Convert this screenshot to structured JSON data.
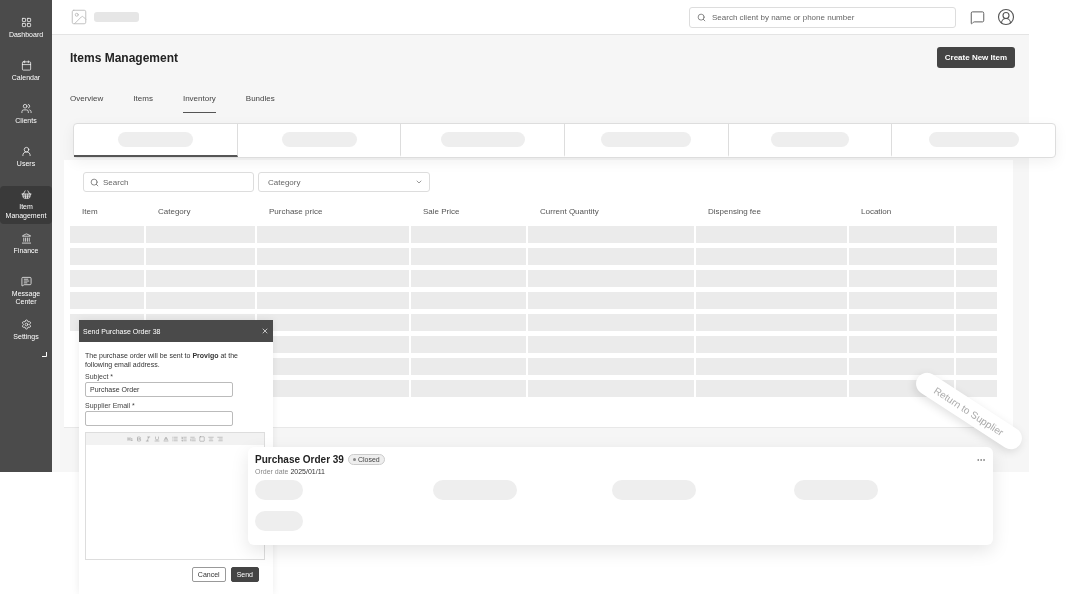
{
  "sidebar": {
    "items": [
      {
        "label": "Dashboard",
        "selected": false
      },
      {
        "label": "Calendar",
        "selected": false
      },
      {
        "label": "Clients",
        "selected": false
      },
      {
        "label": "Users",
        "selected": false
      },
      {
        "label": "Item Management",
        "selected": true
      },
      {
        "label": "Finance",
        "selected": false
      },
      {
        "label": "Message Center",
        "selected": false
      },
      {
        "label": "Settings",
        "selected": false
      }
    ]
  },
  "topbar": {
    "search": {
      "placeholder": "Search client by name or phone number"
    }
  },
  "header": {
    "title": "Items Management",
    "action": "Create New Item"
  },
  "tabs": [
    {
      "label": "Overview",
      "selected": false
    },
    {
      "label": "Items",
      "selected": false
    },
    {
      "label": "Inventory",
      "selected": true
    },
    {
      "label": "Bundles",
      "selected": false
    }
  ],
  "stat_tabs": [
    {
      "selected": true
    },
    {
      "selected": false
    },
    {
      "selected": false
    },
    {
      "selected": false
    },
    {
      "selected": false
    },
    {
      "selected": false
    }
  ],
  "table": {
    "search": {
      "placeholder": "Search"
    },
    "filter": {
      "placeholder": "Category"
    },
    "columns": [
      "Item",
      "Category",
      "Purchase price",
      "Sale Price",
      "Current Quantity",
      "Dispensing fee",
      "Location"
    ]
  },
  "modal": {
    "title": "Send Purchase Order 38",
    "message": "The purchase order will be sent to **Provigo** at the following email address.",
    "fields": [
      {
        "label": "Subject *",
        "value": "Purchase Order"
      },
      {
        "label": "Supplier Email *"
      }
    ],
    "buttons": [
      {
        "label": "Cancel",
        "kind": "secondary"
      },
      {
        "label": "Send",
        "kind": "primary"
      }
    ]
  },
  "purchase_order": {
    "title": "Purchase Order 39",
    "status": "Closed",
    "date_label": "Order date",
    "date": "2025/01/11"
  },
  "return_badge": "Return to Supplier"
}
